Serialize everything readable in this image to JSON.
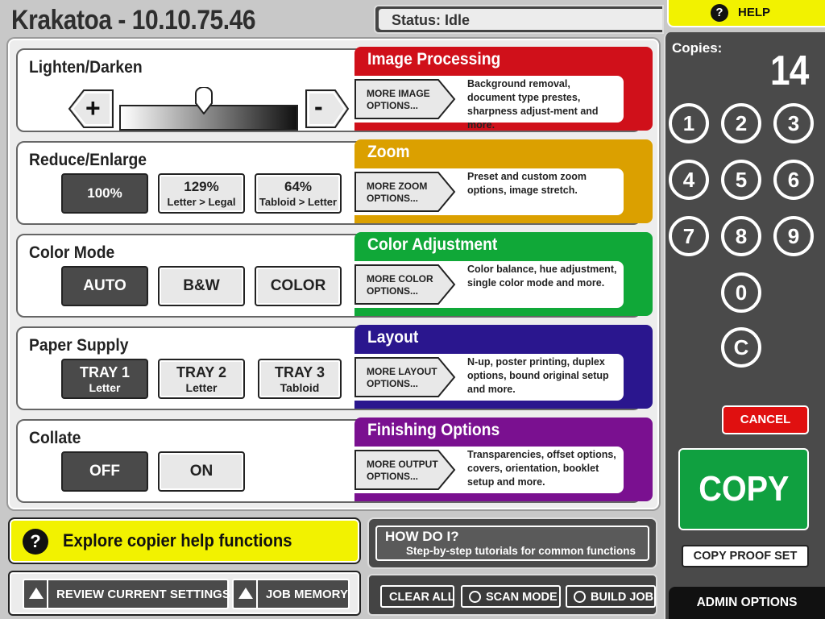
{
  "header": {
    "title": "Krakatoa - 10.10.75.46",
    "status": "Status: Idle",
    "help_label": "HELP",
    "help_glyph": "?"
  },
  "sections": {
    "lighten": {
      "label": "Lighten/Darken",
      "plus": "+",
      "minus": "-",
      "band_title": "Image Processing",
      "band_color": "#d0101a",
      "more": [
        "MORE IMAGE",
        "OPTIONS..."
      ],
      "desc": "Background removal, document type prestes, sharpness adjust-ment and more."
    },
    "reduce": {
      "label": "Reduce/Enlarge",
      "options": [
        {
          "line1": "100%",
          "line2": "",
          "selected": true
        },
        {
          "line1": "129%",
          "line2": "Letter > Legal",
          "selected": false
        },
        {
          "line1": "64%",
          "line2": "Tabloid > Letter",
          "selected": false
        }
      ],
      "band_title": "Zoom",
      "band_color": "#dba000",
      "more": [
        "MORE ZOOM",
        "OPTIONS..."
      ],
      "desc": "Preset and custom zoom options, image stretch."
    },
    "color": {
      "label": "Color Mode",
      "options": [
        {
          "line1": "AUTO",
          "selected": true
        },
        {
          "line1": "B&W",
          "selected": false
        },
        {
          "line1": "COLOR",
          "selected": false
        }
      ],
      "band_title": "Color Adjustment",
      "band_color": "#10a838",
      "more": [
        "MORE COLOR",
        "OPTIONS..."
      ],
      "desc": "Color balance, hue adjustment, single color mode and more."
    },
    "paper": {
      "label": "Paper Supply",
      "options": [
        {
          "line1": "TRAY 1",
          "line2": "Letter",
          "selected": true
        },
        {
          "line1": "TRAY 2",
          "line2": "Letter",
          "selected": false
        },
        {
          "line1": "TRAY 3",
          "line2": "Tabloid",
          "selected": false
        }
      ],
      "band_title": "Layout",
      "band_color": "#2a168e",
      "more": [
        "MORE LAYOUT",
        "OPTIONS..."
      ],
      "desc": "N-up, poster printing, duplex options, bound original setup and more."
    },
    "collate": {
      "label": "Collate",
      "options": [
        {
          "line1": "OFF",
          "selected": true
        },
        {
          "line1": "ON",
          "selected": false
        }
      ],
      "band_title": "Finishing Options",
      "band_color": "#7a1090",
      "more": [
        "MORE OUTPUT",
        "OPTIONS..."
      ],
      "desc": "Transparencies, offset options, covers, orientation, booklet setup and more."
    }
  },
  "explore": {
    "glyph": "?",
    "text": "Explore copier help functions"
  },
  "howdo": {
    "title": "HOW DO I?",
    "subtitle": "Step-by-step tutorials for common functions"
  },
  "bottom_left": {
    "review": "REVIEW CURRENT SETTINGS",
    "memory": "JOB MEMORY"
  },
  "bottom_mid": {
    "clear": "CLEAR ALL",
    "scan": "SCAN MODE",
    "build": "BUILD JOB"
  },
  "copies": {
    "label": "Copies:",
    "value": "14"
  },
  "keypad": [
    "1",
    "2",
    "3",
    "4",
    "5",
    "6",
    "7",
    "8",
    "9",
    "0",
    "C"
  ],
  "cancel": "CANCEL",
  "copy": "COPY",
  "proof": "COPY PROOF SET",
  "admin": "ADMIN OPTIONS"
}
